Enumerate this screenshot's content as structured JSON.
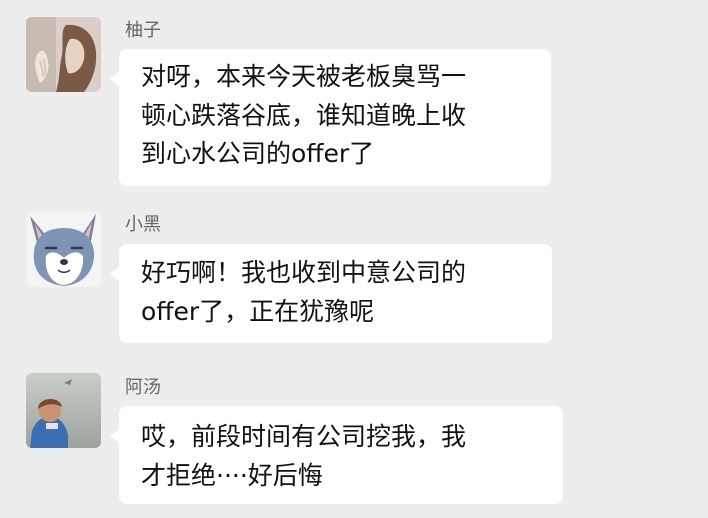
{
  "messages": [
    {
      "sender": "柚子",
      "avatar": "girl-photo-avatar",
      "lines": [
        "对呀，本来今天被老板臭骂一",
        "顿心跌落谷底，谁知道晚上收",
        "到心水公司的offer了"
      ]
    },
    {
      "sender": "小黑",
      "avatar": "shiba-dog-avatar",
      "lines": [
        "好巧啊！我也收到中意公司的",
        "offer了，正在犹豫呢"
      ]
    },
    {
      "sender": "阿汤",
      "avatar": "child-photo-avatar",
      "lines": [
        "哎，前段时间有公司挖我，我",
        "才拒绝····好后悔"
      ]
    }
  ],
  "colors": {
    "background": "#ededed",
    "bubble": "#ffffff",
    "sender_text": "#666666",
    "message_text": "#111111"
  }
}
